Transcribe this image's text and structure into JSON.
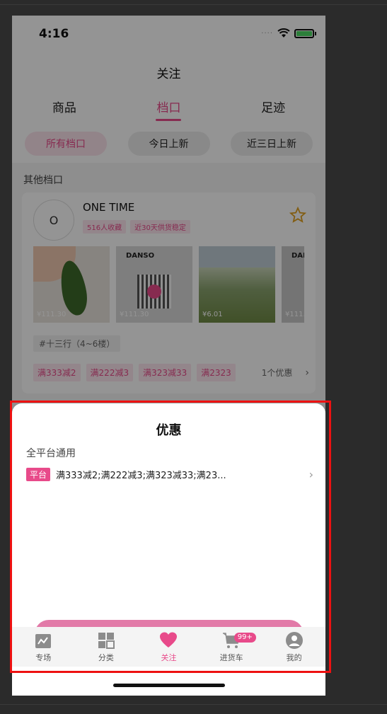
{
  "status_bar": {
    "time": "4:16"
  },
  "nav": {
    "title": "关注"
  },
  "tabs": [
    "商品",
    "档口",
    "足迹"
  ],
  "filters": [
    "所有档口",
    "今日上新",
    "近三日上新"
  ],
  "section_title": "其他档口",
  "shop": {
    "avatar_letter": "O",
    "name": "ONE TIME",
    "badges": [
      "516人收藏",
      "近30天供货稳定"
    ],
    "products": [
      {
        "price": "¥111.30"
      },
      {
        "price": "¥111.30"
      },
      {
        "price": "¥6.01"
      },
      {
        "price": "¥111.30"
      }
    ],
    "product_brand": "DANSO",
    "market": "#十三行（4~6楼）",
    "discount_tags": [
      "满333减2",
      "满222减3",
      "满323减33",
      "满2323"
    ],
    "discount_count": "1个优惠"
  },
  "sheet": {
    "title": "优惠",
    "scope": "全平台通用",
    "platform_tag": "平台",
    "promo_text": "满333减2;满222减3;满323减33;满23..."
  },
  "tabbar": {
    "items": [
      {
        "label": "专场",
        "icon": "calendar-icon"
      },
      {
        "label": "分类",
        "icon": "grid-icon"
      },
      {
        "label": "关注",
        "icon": "heart-icon"
      },
      {
        "label": "进货车",
        "icon": "cart-icon"
      },
      {
        "label": "我的",
        "icon": "profile-icon"
      }
    ],
    "cart_badge": "99+"
  },
  "colors": {
    "accent": "#e84a8a",
    "highlight_frame": "#e11111"
  }
}
